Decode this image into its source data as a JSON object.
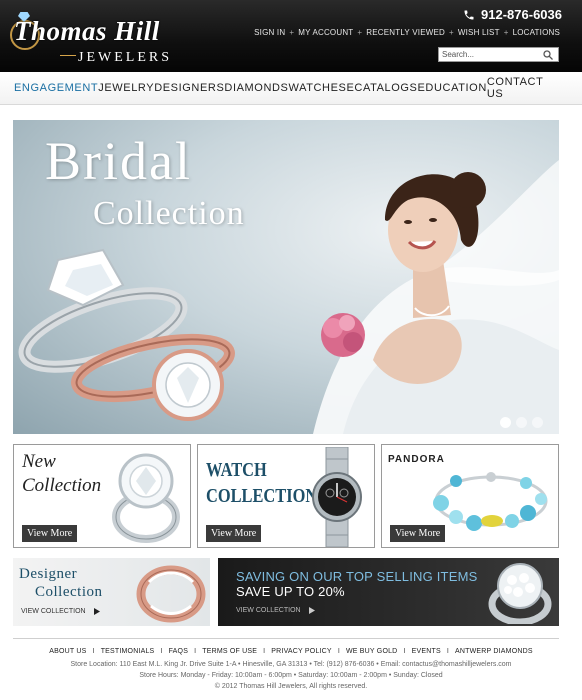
{
  "header": {
    "logo_main": "Thomas Hill",
    "logo_sub": "JEWELERS",
    "phone": "912-876-6036",
    "top_links": [
      "SIGN IN",
      "MY ACCOUNT",
      "RECENTLY VIEWED",
      "WISH LIST",
      "LOCATIONS"
    ],
    "search_placeholder": "Search..."
  },
  "nav": {
    "items": [
      "ENGAGEMENT",
      "JEWELRY",
      "DESIGNERS",
      "DIAMONDS",
      "WATCHES",
      "ECATALOGS",
      "EDUCATION",
      "CONTACT US"
    ],
    "active_index": 0
  },
  "hero": {
    "title_line1": "Bridal",
    "title_line2": "Collection",
    "slides_total": 3,
    "active_slide": 1
  },
  "tiles": [
    {
      "title_line1": "New",
      "title_line2": "Collection",
      "button": "View More"
    },
    {
      "title_line1": "WATCH",
      "title_line2": "COLLECTION",
      "button": "View More"
    },
    {
      "brand": "PANDORA",
      "button": "View More"
    }
  ],
  "banners": {
    "designer": {
      "line1": "Designer",
      "line2": "Collection",
      "link": "VIEW COLLECTION"
    },
    "saving": {
      "line1": "SAVING ON OUR TOP SELLING ITEMS",
      "line2": "SAVE UP TO 20%",
      "link": "VIEW COLLECTION"
    }
  },
  "footer": {
    "links": [
      "ABOUT US",
      "TESTIMONIALS",
      "FAQS",
      "TERMS OF USE",
      "PRIVACY POLICY",
      "WE BUY GOLD",
      "EVENTS",
      "ANTWERP DIAMONDS"
    ],
    "address": "Store Location: 110 East M.L. King Jr. Drive Suite 1-A • Hinesville,  GA  31313 • Tel: (912) 876-6036 • Email: contactus@thomashilljewelers.com",
    "hours": "Store Hours: Monday - Friday: 10:00am - 6:00pm • Saturday: 10:00am - 2:00pm • Sunday: Closed",
    "copyright": "© 2012 Thomas Hill Jewelers, All rights reserved."
  },
  "colors": {
    "header_bg": "#0f0f0f",
    "nav_active": "#1a6fa3",
    "brand_blue": "#1d4f68",
    "rose_gold": "#d89a86"
  },
  "icons": [
    "phone-icon",
    "search-icon",
    "arrow-right-icon"
  ]
}
